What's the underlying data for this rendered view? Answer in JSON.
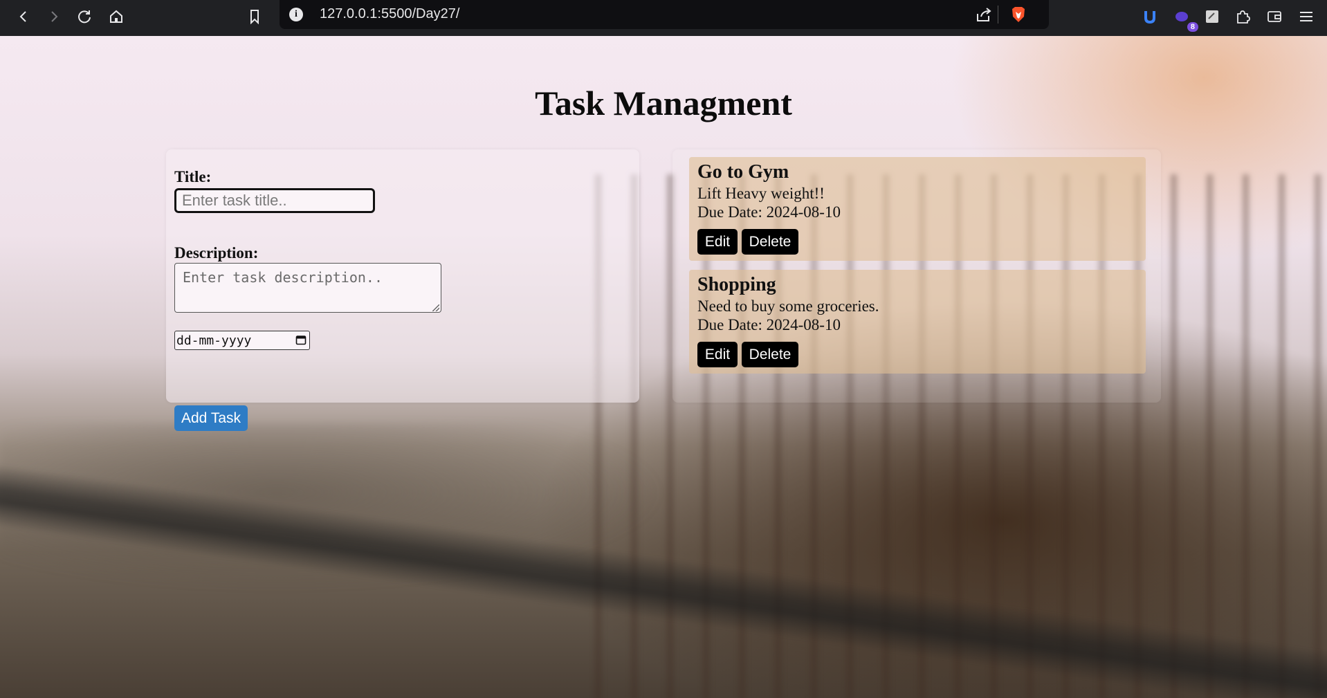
{
  "browser": {
    "url": "127.0.0.1:5500/Day27/",
    "extension_badge": "8"
  },
  "page": {
    "heading": "Task Managment"
  },
  "form": {
    "title_label": "Title:",
    "title_placeholder": "Enter task title..",
    "title_value": "",
    "description_label": "Description:",
    "description_placeholder": "Enter task description..",
    "date_placeholder": "dd-mm-yyyy",
    "add_button": "Add Task"
  },
  "tasks": [
    {
      "title": "Go to Gym",
      "description": "Lift Heavy weight!!",
      "due": "Due Date: 2024-08-10",
      "edit_label": "Edit",
      "delete_label": "Delete"
    },
    {
      "title": "Shopping",
      "description": "Need to buy some groceries.",
      "due": "Due Date: 2024-08-10",
      "edit_label": "Edit",
      "delete_label": "Delete"
    }
  ],
  "colors": {
    "add_button": "#2e7cc5",
    "action_button": "#000000",
    "task_card": "#debe96"
  }
}
